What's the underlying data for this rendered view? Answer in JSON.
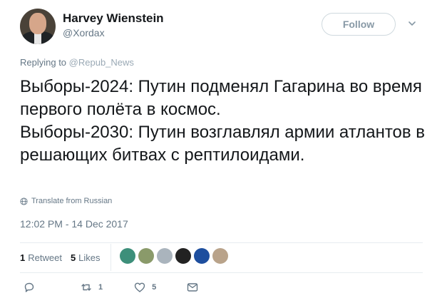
{
  "user": {
    "name": "Harvey Wienstein",
    "handle": "@Xordax"
  },
  "follow_button": {
    "label": "Follow"
  },
  "reply": {
    "prefix": "Replying to",
    "mention": "@Repub_News"
  },
  "tweet": {
    "text": "Выборы-2024: Путин подменял Гагарина во время первого полёта в космос.\nВыборы-2030: Путин возглавлял армии атлантов в решающих битвах с рептилоидами.",
    "translate_label": "Translate from Russian",
    "timestamp": "12:02 PM - 14 Dec 2017"
  },
  "stats": {
    "retweets_count": "1",
    "retweets_label": "Retweet",
    "likes_count": "5",
    "likes_label": "Likes"
  },
  "likers": [
    {
      "name": "liker-avatar-1",
      "color": "#3d8f7a"
    },
    {
      "name": "liker-avatar-2",
      "color": "#8a9a6a"
    },
    {
      "name": "liker-avatar-3",
      "color": "#aab4bd"
    },
    {
      "name": "liker-avatar-4",
      "color": "#222222"
    },
    {
      "name": "liker-avatar-5",
      "color": "#1d4e9e"
    },
    {
      "name": "liker-avatar-6",
      "color": "#b9a38a"
    }
  ],
  "actions": {
    "reply_icon": "reply-icon",
    "retweet_count": "1",
    "like_count": "5",
    "message_icon": "message-icon"
  },
  "colors": {
    "text": "#14171a",
    "secondary": "#657786",
    "divider": "#e6ecf0"
  }
}
